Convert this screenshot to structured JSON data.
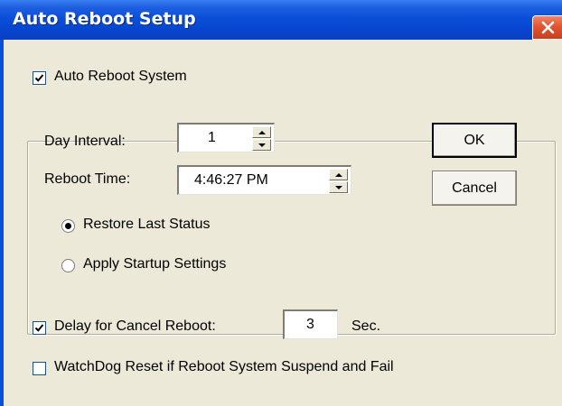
{
  "window": {
    "title": "Auto Reboot Setup"
  },
  "auto_reboot": {
    "label": "Auto Reboot System",
    "checked": true
  },
  "interval": {
    "label": "Day Interval:",
    "value": "1"
  },
  "reboot_time": {
    "label": "Reboot Time:",
    "value": "4:46:27 PM"
  },
  "mode": {
    "restore_label": "Restore Last Status",
    "apply_label": "Apply Startup Settings",
    "selected": "restore"
  },
  "buttons": {
    "ok": "OK",
    "cancel": "Cancel"
  },
  "delay": {
    "label": "Delay for Cancel Reboot:",
    "value": "3",
    "unit": "Sec.",
    "checked": true
  },
  "watchdog": {
    "label": "WatchDog Reset if Reboot System Suspend and Fail",
    "checked": false
  },
  "colors": {
    "titlebar": "#0a4fd8",
    "close": "#e2552f",
    "face": "#ece9d8"
  }
}
